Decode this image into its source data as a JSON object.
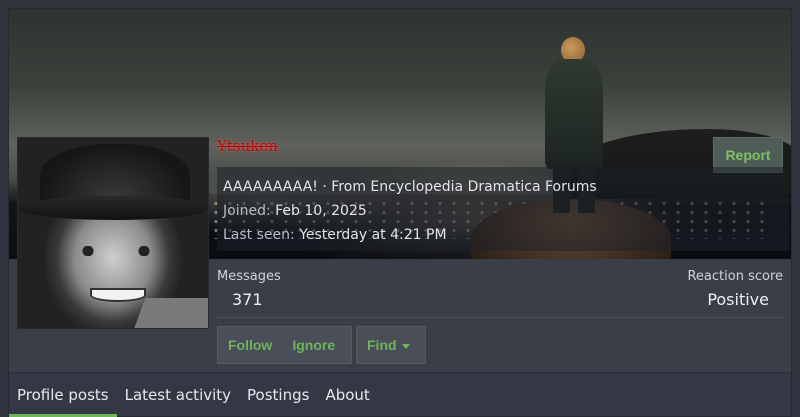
{
  "profile": {
    "username": "Ytsuken",
    "title_line": "AAAAAAAAA! · From Encyclopedia Dramatica Forums",
    "joined_label": "Joined:",
    "joined_value": "Feb 10, 2025",
    "last_seen_label": "Last seen:",
    "last_seen_value": "Yesterday at 4:21 PM"
  },
  "actions": {
    "report": "Report",
    "follow": "Follow",
    "ignore": "Ignore",
    "find": "Find"
  },
  "stats": {
    "messages_label": "Messages",
    "messages_value": "371",
    "reaction_label": "Reaction score",
    "reaction_value": "Positive"
  },
  "tabs": [
    {
      "label": "Profile posts",
      "active": true
    },
    {
      "label": "Latest activity",
      "active": false
    },
    {
      "label": "Postings",
      "active": false
    },
    {
      "label": "About",
      "active": false
    }
  ],
  "colors": {
    "accent": "#6fb35a",
    "username": "#9b1010",
    "background": "#3a3e49"
  },
  "icons": {
    "find_dropdown": "caret-down-icon"
  }
}
